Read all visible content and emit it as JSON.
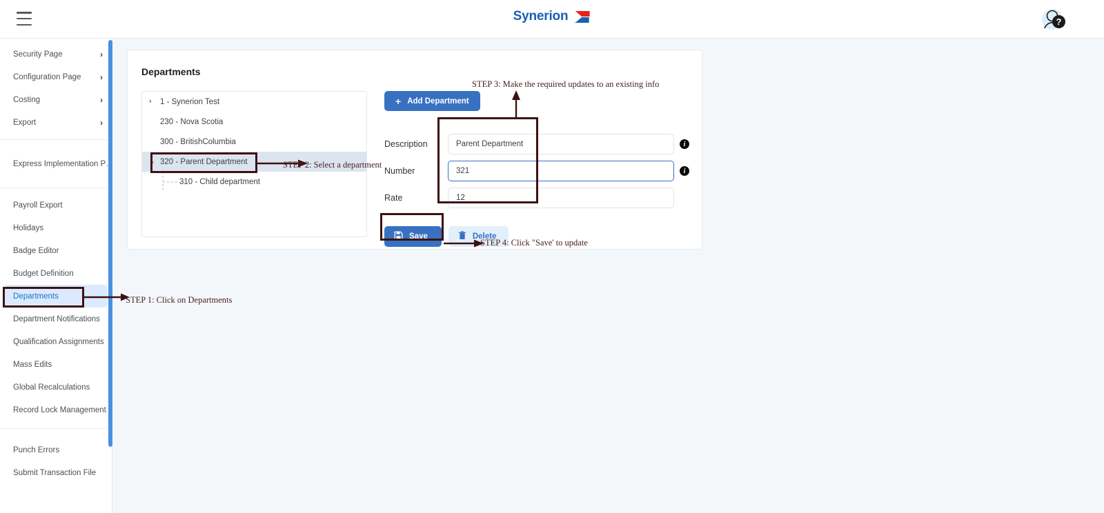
{
  "topbar": {
    "menu_icon": "hamburger-icon",
    "brand_name": "Synerion",
    "brand_mark_icon": "synerion-logo-mark",
    "brand_color": "#1a5fb4",
    "help_icon": "avatar-help-icon"
  },
  "sidebar": {
    "groups": [
      {
        "items": [
          {
            "label": "Security Page",
            "chevron": "›",
            "active": false
          },
          {
            "label": "Configuration Page",
            "chevron": "›",
            "active": false
          },
          {
            "label": "Costing",
            "chevron": "›",
            "active": false
          },
          {
            "label": "Export",
            "chevron": "›",
            "active": false
          }
        ]
      },
      {
        "items": [
          {
            "label": "Express Implementation P…",
            "chevron": "",
            "active": false
          }
        ]
      },
      {
        "items": [
          {
            "label": "Payroll Export",
            "chevron": "",
            "active": false
          },
          {
            "label": "Holidays",
            "chevron": "",
            "active": false
          },
          {
            "label": "Badge Editor",
            "chevron": "",
            "active": false
          },
          {
            "label": "Budget Definition",
            "chevron": "",
            "active": false
          },
          {
            "label": "Departments",
            "chevron": "",
            "active": true
          },
          {
            "label": "Department Notifications",
            "chevron": "",
            "active": false
          },
          {
            "label": "Qualification Assignments",
            "chevron": "",
            "active": false
          },
          {
            "label": "Mass Edits",
            "chevron": "",
            "active": false
          },
          {
            "label": "Global Recalculations",
            "chevron": "",
            "active": false
          },
          {
            "label": "Record Lock Management",
            "chevron": "",
            "active": false
          }
        ]
      },
      {
        "items": [
          {
            "label": "Punch Errors",
            "chevron": "",
            "active": false
          },
          {
            "label": "Submit Transaction File",
            "chevron": "",
            "active": false
          }
        ]
      }
    ],
    "active_bg": "#dbeafe",
    "active_color": "#1a73c8",
    "scrollbar_color": "#4a90e2"
  },
  "card": {
    "title": "Departments"
  },
  "tree": {
    "nodes": [
      {
        "label": "1 - Synerion Test",
        "caret": "›",
        "indent": false,
        "selected": false
      },
      {
        "label": "230 - Nova Scotia",
        "caret": "",
        "indent": false,
        "selected": false
      },
      {
        "label": "300 - BritishColumbia",
        "caret": "",
        "indent": false,
        "selected": false
      },
      {
        "label": "320 - Parent Department",
        "caret": "⌄",
        "indent": false,
        "selected": true
      },
      {
        "label": "310 - Child department",
        "caret": "",
        "indent": true,
        "selected": false
      }
    ],
    "selected_bg": "#dce4f0"
  },
  "form": {
    "add_button": {
      "label": "Add Department",
      "icon": "plus-icon"
    },
    "fields": [
      {
        "label": "Description",
        "value": "Parent Department",
        "placeholder": "Description",
        "focused": false,
        "info": true
      },
      {
        "label": "Number",
        "value": "321",
        "placeholder": "Number",
        "focused": true,
        "info": true
      },
      {
        "label": "Rate",
        "value": "12",
        "placeholder": "Rate",
        "focused": false,
        "info": false
      }
    ],
    "save_button": {
      "label": "Save",
      "icon": "save-disk-icon"
    },
    "delete_button": {
      "label": "Delete",
      "icon": "trash-icon"
    },
    "accent_color": "#3871c1"
  },
  "annotations": {
    "color": "#4a2020",
    "step1": "STEP 1: Click on Departments",
    "step2": "STEP 2: Select a department",
    "step3": "STEP 3: Make the required updates to an existing info",
    "step4": "STEP 4: Click \"Save' to update"
  }
}
